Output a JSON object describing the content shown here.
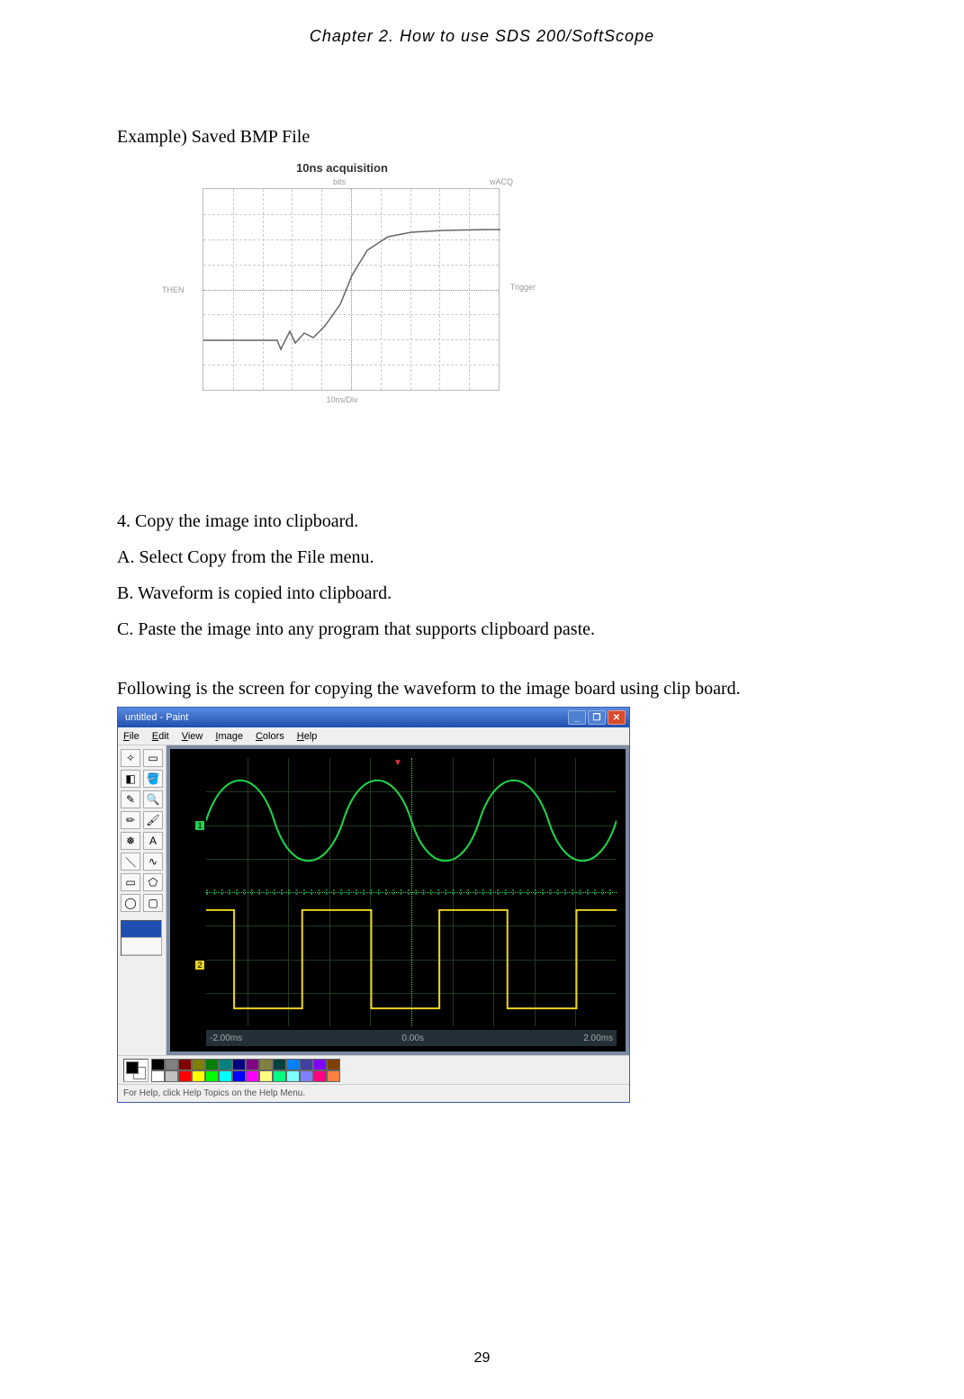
{
  "header": "Chapter 2. How to use SDS 200/SoftScope",
  "example_caption": "Example) Saved BMP File",
  "bmp": {
    "title": "10ns acquisition",
    "sub_left": "bits",
    "sub_right": "wACQ",
    "left_label": "THEN",
    "right_label": "Trigger",
    "bottom_label": "10ns/Div"
  },
  "steps": {
    "s4": "4. Copy the image into clipboard.",
    "sA": "A. Select Copy from the File menu.",
    "sB": "B. Waveform is copied into clipboard.",
    "sC": "C. Paste the image into any program that supports clipboard paste."
  },
  "follow": "Following is the screen for copying the waveform to the image board using clip board.",
  "paint": {
    "title": "untitled - Paint",
    "menus": [
      "File",
      "Edit",
      "View",
      "Image",
      "Colors",
      "Help"
    ],
    "status": "For Help, click Help Topics on the Help Menu.",
    "bottom_left": "-2.00ms",
    "bottom_center": "0.00s",
    "bottom_right": "2.00ms",
    "win_min": "_",
    "win_max": "❐",
    "win_close": "✕"
  },
  "palette_colors": [
    "#000000",
    "#808080",
    "#800000",
    "#808000",
    "#008000",
    "#008080",
    "#000080",
    "#800080",
    "#808040",
    "#004040",
    "#0080ff",
    "#4040a0",
    "#8000ff",
    "#804000",
    "#ffffff",
    "#c0c0c0",
    "#ff0000",
    "#ffff00",
    "#00ff00",
    "#00ffff",
    "#0000ff",
    "#ff00ff",
    "#ffff80",
    "#00ff80",
    "#80ffff",
    "#8080ff",
    "#ff0080",
    "#ff8040"
  ],
  "page_number": "29",
  "chart_data": {
    "type": "line",
    "title": "10ns acquisition",
    "xlabel": "10ns/Div",
    "x_range_divs": 10,
    "y_range_divs": 8,
    "note": "Single-channel step response with ringing; values are in grid-division units (x: 0–10 divs left→right, y: -4 to +4 divs from center).",
    "series": [
      {
        "name": "CH trace",
        "x": [
          0.0,
          2.5,
          2.6,
          2.9,
          3.1,
          3.4,
          3.7,
          4.1,
          4.6,
          5.0,
          5.5,
          6.2,
          7.0,
          8.0,
          9.5,
          10.0
        ],
        "y": [
          -2.0,
          -2.0,
          -2.3,
          -1.6,
          -2.1,
          -1.7,
          -1.9,
          -1.4,
          -0.6,
          0.6,
          1.5,
          2.0,
          2.2,
          2.3,
          2.3,
          2.3
        ]
      }
    ]
  }
}
